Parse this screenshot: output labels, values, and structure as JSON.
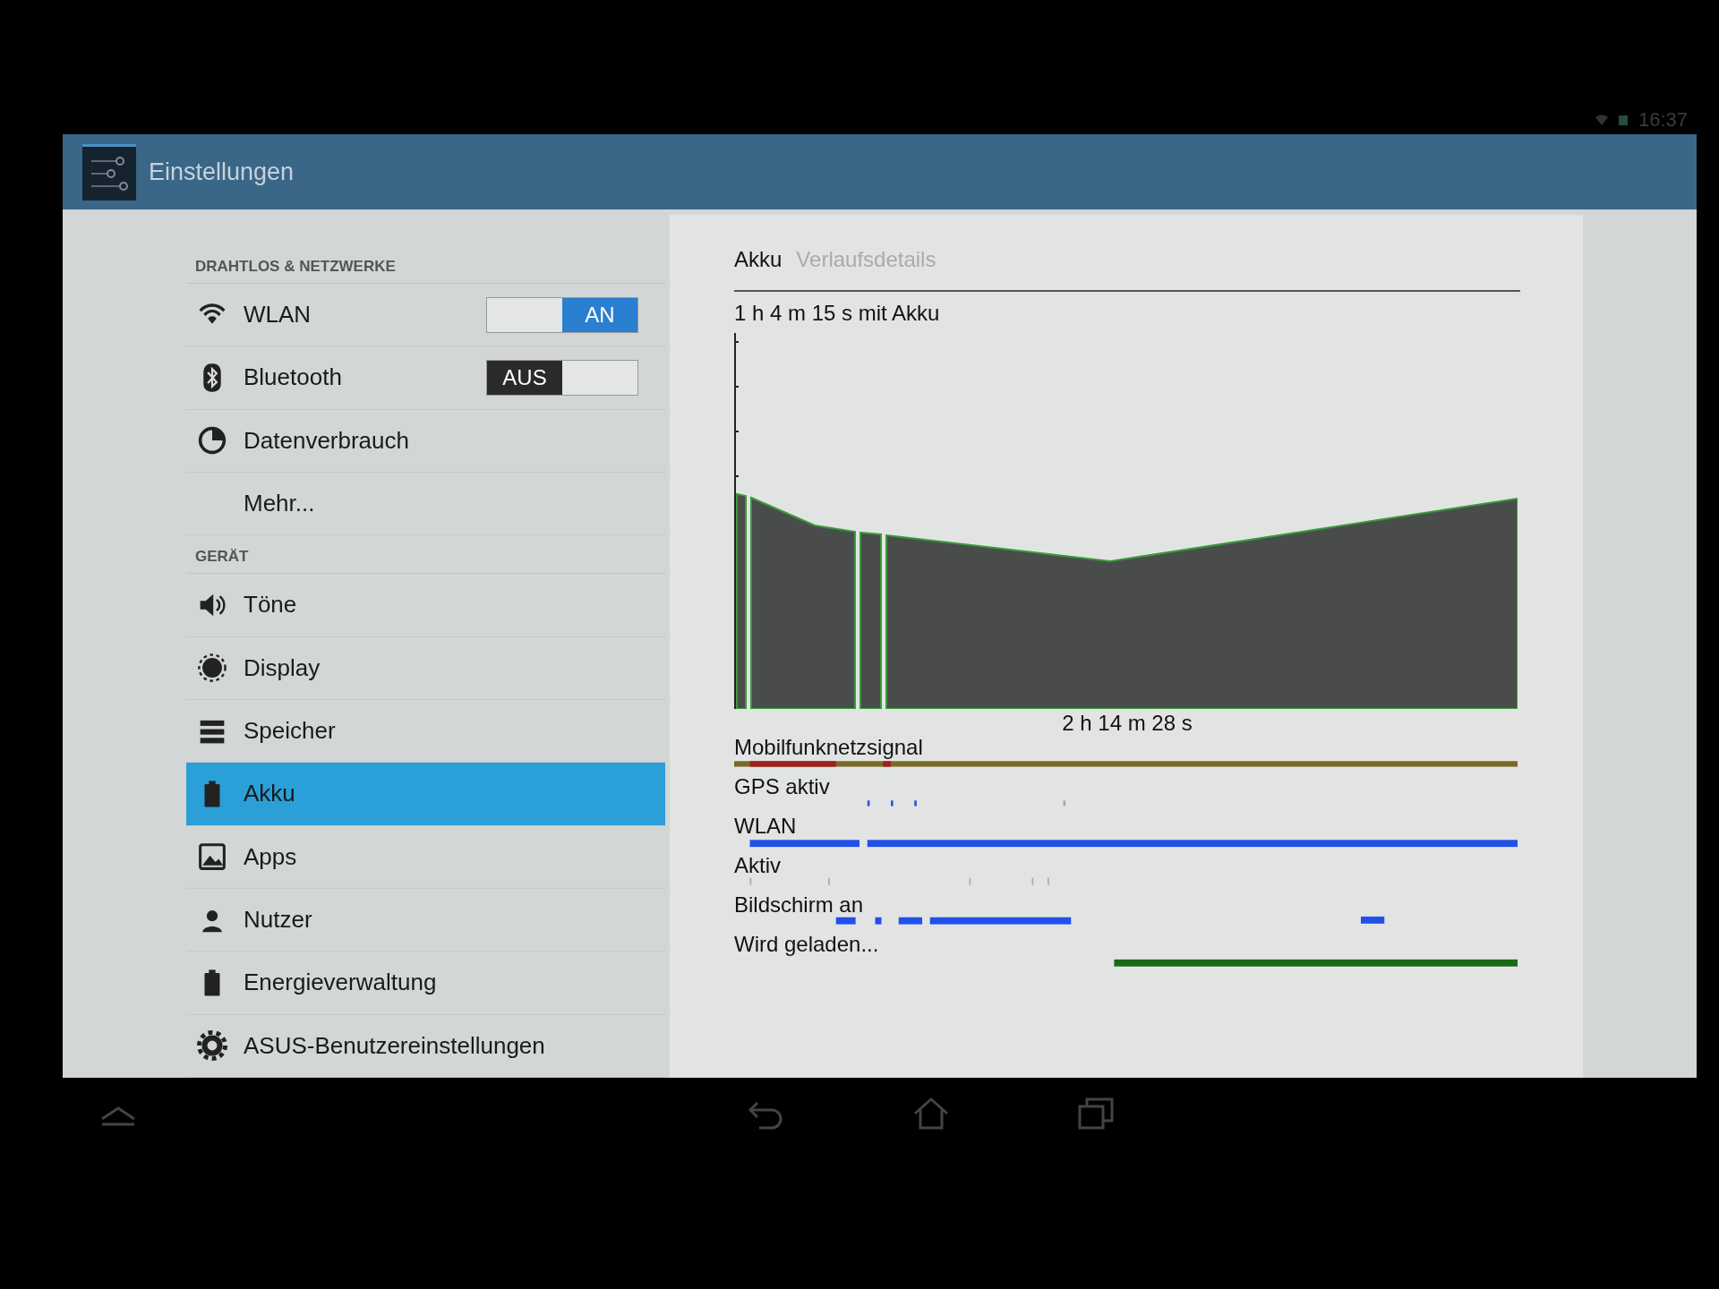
{
  "status_bar": {
    "time": "16:37"
  },
  "action_bar": {
    "title": "Einstellungen"
  },
  "sidebar": {
    "items": [
      {
        "kind": "header",
        "label": "DRAHTLOS & NETZWERKE"
      },
      {
        "kind": "toggle",
        "label": "WLAN",
        "on": true,
        "on_label": "AN",
        "selected": false
      },
      {
        "kind": "toggle",
        "label": "Bluetooth",
        "on": false,
        "off_label": "AUS",
        "selected": false
      },
      {
        "kind": "item",
        "label": "Datenverbrauch",
        "selected": false
      },
      {
        "kind": "item",
        "label": "Mehr...",
        "selected": false
      },
      {
        "kind": "header",
        "label": "GERÄT"
      },
      {
        "kind": "item",
        "label": "Töne",
        "selected": false
      },
      {
        "kind": "item",
        "label": "Display",
        "selected": false
      },
      {
        "kind": "item",
        "label": "Speicher",
        "selected": false
      },
      {
        "kind": "item",
        "label": "Akku",
        "selected": true
      },
      {
        "kind": "item",
        "label": "Apps",
        "selected": false
      },
      {
        "kind": "item",
        "label": "Nutzer",
        "selected": false
      },
      {
        "kind": "item",
        "label": "Energieverwaltung",
        "selected": false
      },
      {
        "kind": "item",
        "label": "ASUS-Benutzereinstellungen",
        "selected": false
      }
    ]
  },
  "panel": {
    "tabs": [
      {
        "label": "Akku",
        "selected": true
      },
      {
        "label": "Verlaufsdetails",
        "selected": false
      }
    ],
    "summary": "1 h 4 m 15 s mit Akku",
    "duration": "2 h 14 m 28 s",
    "timelines": [
      {
        "label": "Mobilfunknetzsignal"
      },
      {
        "label": "GPS aktiv"
      },
      {
        "label": "WLAN"
      },
      {
        "label": "Aktiv"
      },
      {
        "label": "Bildschirm an"
      },
      {
        "label": "Wird geladen..."
      }
    ]
  }
}
